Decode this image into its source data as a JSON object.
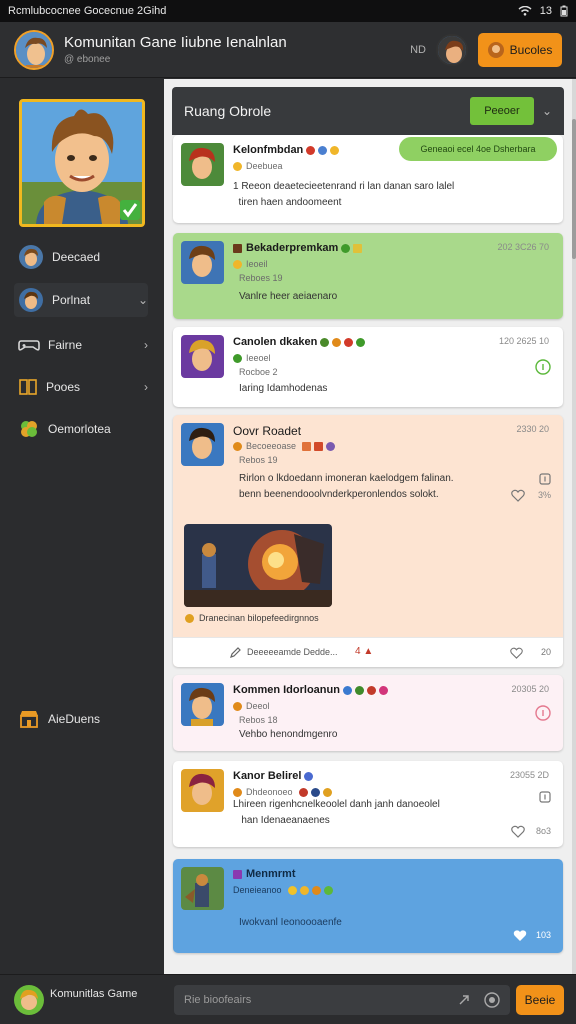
{
  "status_bar": {
    "carrier": "Rcmlubcocnee Gocecnue 2Gihd",
    "battery": "13"
  },
  "header": {
    "title": "Komunitan Gane Iiubne Ienalnlan",
    "subtitle": "@ ebonee",
    "badge": "ND",
    "button": "Bucoles"
  },
  "sidebar": {
    "items": [
      {
        "label": "Deecaed",
        "icon": "avatar-icon",
        "chev": false
      },
      {
        "label": "Porlnat",
        "icon": "avatar-icon",
        "chev": true
      },
      {
        "label": "Fairne",
        "icon": "gamepad-icon",
        "chev": true
      },
      {
        "label": "Pooes",
        "icon": "book-icon",
        "chev": true
      },
      {
        "label": "Oemorlotea",
        "icon": "clover-icon",
        "chev": false
      }
    ],
    "bottom_item": "AieDuens"
  },
  "feed": {
    "title": "Ruang Obrole",
    "button": "Peeoer",
    "posts": [
      {
        "name": "Kelonfmbdan",
        "meta": "Deebuea",
        "body": "1 Reeon deaetecieetenrand ri lan danan saro lalel\n  tiren haen andoomeent",
        "tag": "Geneaoi ecel 4oe Dsherbara"
      },
      {
        "name": "Bekaderpremkam",
        "meta": "Ieoeil",
        "meta2": "Reboes 19",
        "body": "Vanlre heer aeiaenaro",
        "time": "202 3C26 70"
      },
      {
        "name": "Canolen dkaken",
        "meta": "Ieeoel",
        "meta2": "Rocboe 2",
        "body": "Iaring Idamhodenas",
        "time": "120 2625 10"
      },
      {
        "name": "Oovr Roadet",
        "meta": "Becoeeoase",
        "meta2": "Rebos 19",
        "body": "Rirlon o lkdoedann imoneran kaelodgem falinan.\nbenn beenendooolvnderkperonlendos solokt.",
        "time": "2330 20",
        "caption": "Dranecinan bilopefeedirgnnos",
        "footer": "Deeeeeamde Dedde...",
        "reply": "20"
      },
      {
        "name": "Kommen Idorloanun",
        "meta": "Deeol",
        "meta2": "Rebos 18",
        "body": "Vehbo henondmgenro",
        "time": "20305 20"
      },
      {
        "name": "Kanor Belirel",
        "meta": "Dhdeonoeo",
        "body": "Lhireen rigenhcnelkeoolel danh janh danoeolel\n   han Idenaeanaenes",
        "time": "23055 2D",
        "reply": "8o3"
      },
      {
        "name": "Menmrmt",
        "meta": "Deneieanoo",
        "body": "Iwokvanl Ieonoooaenfe",
        "reply": "103"
      }
    ]
  },
  "composer": {
    "label": "Komunitlas Game",
    "placeholder": "Rie bioofeairs",
    "button": "Beeie"
  }
}
